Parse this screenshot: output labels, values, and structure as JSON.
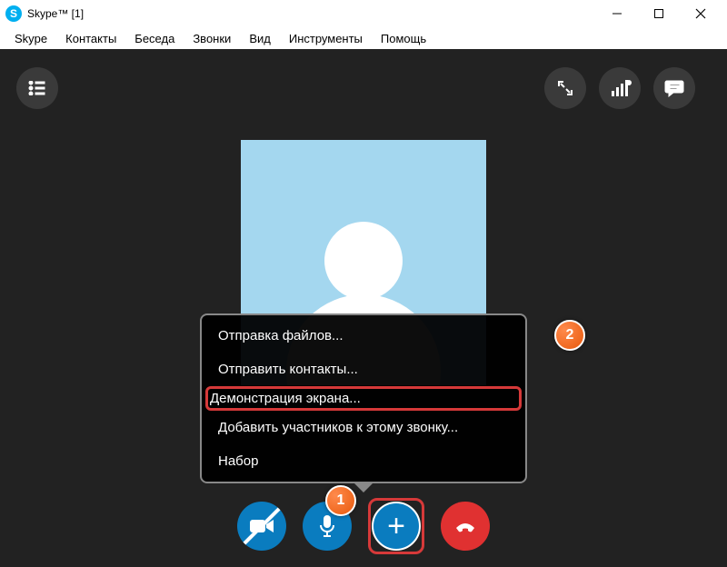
{
  "window": {
    "title": "Skype™ [1]"
  },
  "menubar": [
    "Skype",
    "Контакты",
    "Беседа",
    "Звонки",
    "Вид",
    "Инструменты",
    "Помощь"
  ],
  "popup": {
    "items": [
      "Отправка файлов...",
      "Отправить контакты...",
      "Демонстрация экрана...",
      "Добавить участников к этому звонку...",
      "Набор"
    ],
    "highlighted_index": 2
  },
  "annotations": {
    "one": "1",
    "two": "2"
  },
  "icons": {
    "plus_glyph": "+"
  }
}
